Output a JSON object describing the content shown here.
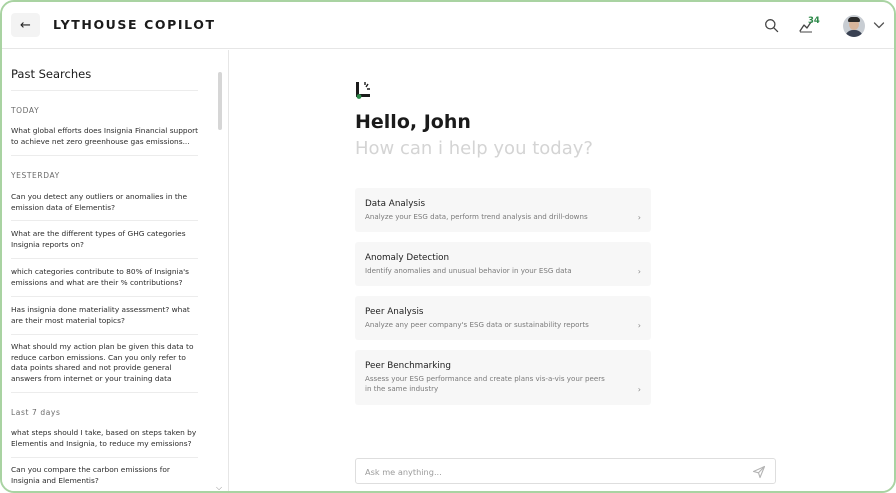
{
  "header": {
    "back_icon": "←",
    "title": "LYTHOUSE COPILOT",
    "notification_count": "34",
    "accent_color": "#2e8a4a"
  },
  "sidebar": {
    "title": "Past Searches",
    "groups": [
      {
        "label": "TODAY",
        "items": [
          "What global efforts does Insignia Financial support to achieve net zero greenhouse gas emissions..."
        ]
      },
      {
        "label": "YESTERDAY",
        "items": [
          "Can you detect any outliers or anomalies in the emission data of Elementis?",
          "What are the different types of GHG categories Insignia reports on?",
          "which categories contribute to 80% of Insignia's emissions and what are their % contributions?",
          "Has insignia done materiality assessment? what are their most material topics?",
          "What should my action plan be given this data to reduce carbon emissions. Can you only refer to data points shared and not provide general answers from internet or your training data"
        ]
      },
      {
        "label": "Last 7 days",
        "items": [
          "what steps should I take, based on steps taken by Elementis and Insignia, to reduce my emissions?",
          "Can you compare the carbon emissions for Insignia and Elementis?"
        ]
      }
    ]
  },
  "main": {
    "greeting": "Hello, John",
    "subtitle": "How can i help you today?",
    "cards": [
      {
        "title": "Data Analysis",
        "description": "Analyze your ESG data, perform trend analysis and drill-downs"
      },
      {
        "title": "Anomaly Detection",
        "description": "Identify anomalies and unusual behavior in your ESG data"
      },
      {
        "title": "Peer Analysis",
        "description": "Analyze any peer company's ESG data or sustainability reports"
      },
      {
        "title": "Peer Benchmarking",
        "description": "Assess your ESG performance and create plans vis-a-vis your peers in the same industry"
      }
    ],
    "chevron": "›",
    "ask": {
      "placeholder": "Ask me anything...",
      "value": ""
    }
  }
}
